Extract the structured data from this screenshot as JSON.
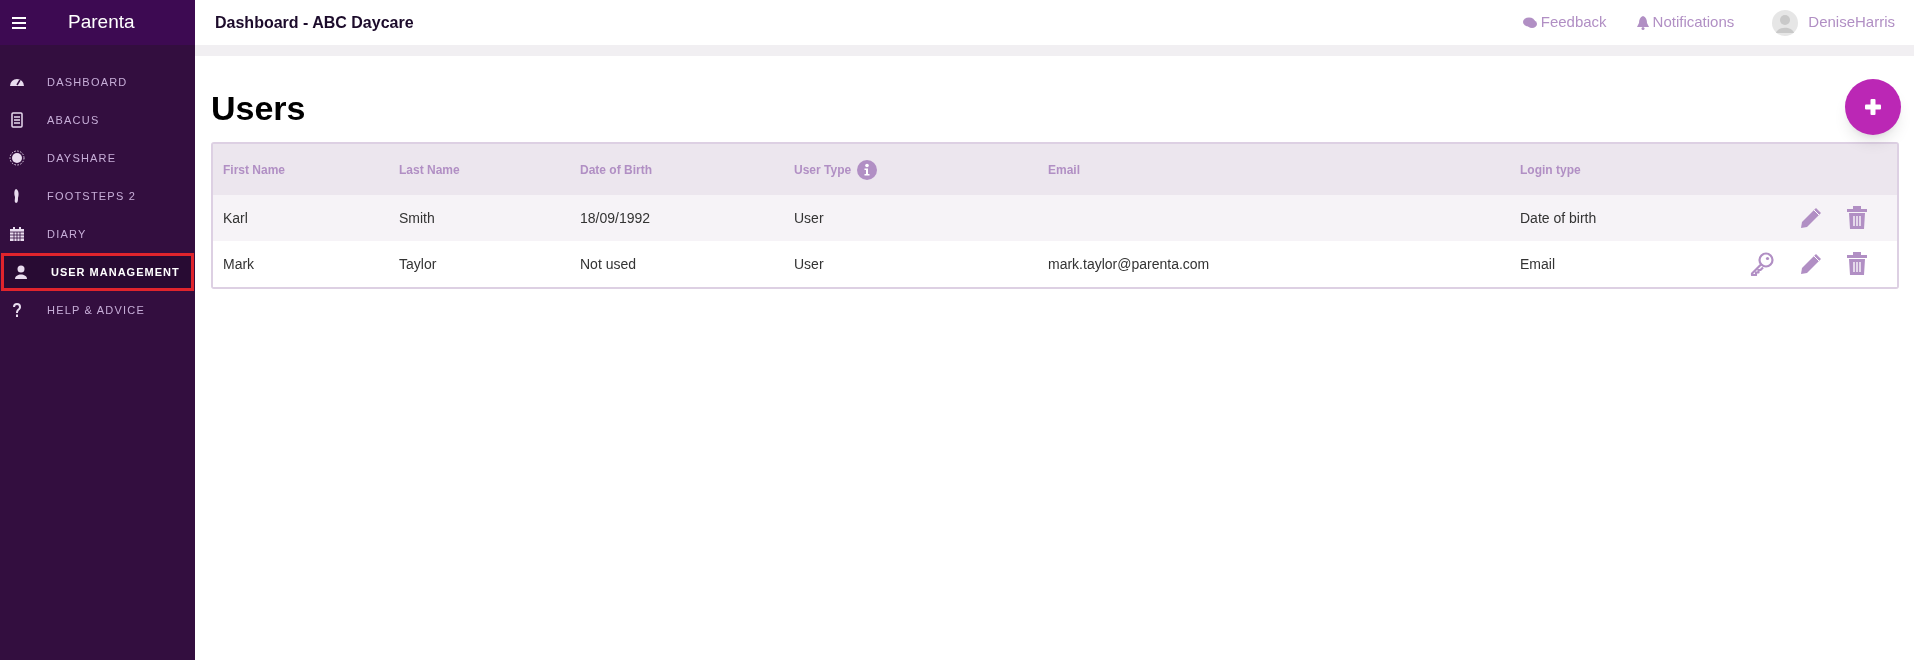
{
  "sidebar": {
    "brand": "Parenta",
    "items": [
      {
        "label": "DASHBOARD",
        "selected": false
      },
      {
        "label": "ABACUS",
        "selected": false
      },
      {
        "label": "DAYSHARE",
        "selected": false
      },
      {
        "label": "FOOTSTEPS 2",
        "selected": false
      },
      {
        "label": "DIARY",
        "selected": false
      },
      {
        "label": "USER MANAGEMENT",
        "selected": true
      },
      {
        "label": "HELP & ADVICE",
        "selected": false
      }
    ]
  },
  "header": {
    "title": "Dashboard - ABC Daycare",
    "feedback": "Feedback",
    "notifications": "Notifications",
    "user": "DeniseHarris"
  },
  "page_title": "Users",
  "table": {
    "columns": [
      {
        "label": "First Name",
        "info": false
      },
      {
        "label": "Last Name",
        "info": false
      },
      {
        "label": "Date of Birth",
        "info": false
      },
      {
        "label": "User Type",
        "info": true
      },
      {
        "label": "Email",
        "info": false
      },
      {
        "label": "Login type",
        "info": false
      }
    ],
    "rows": [
      {
        "cells": [
          "Karl",
          "Smith",
          "18/09/1992",
          "User",
          "",
          "Date of birth"
        ],
        "password_key": false
      },
      {
        "cells": [
          "Mark",
          "Taylor",
          "Not used",
          "User",
          "mark.taylor@parenta.com",
          "Email"
        ],
        "password_key": true
      }
    ]
  }
}
